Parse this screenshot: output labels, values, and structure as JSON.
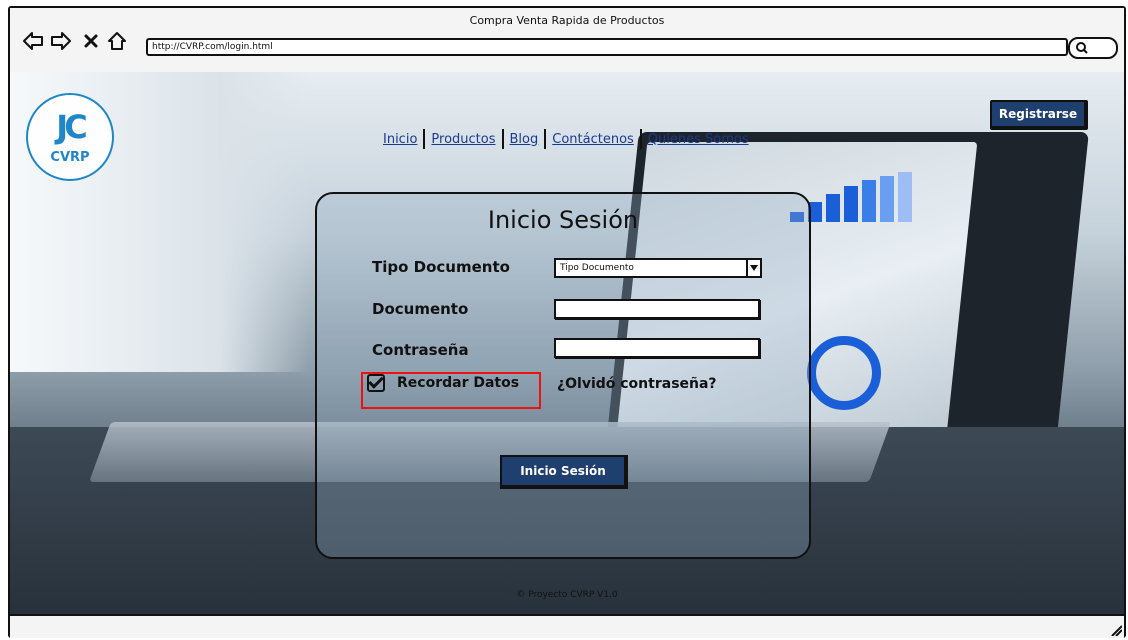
{
  "browser": {
    "title": "Compra Venta Rapida de Productos",
    "url": "http://CVRP.com/login.html"
  },
  "logo": {
    "mark": "JC",
    "text": "CVRP"
  },
  "nav": {
    "items": [
      "Inicio",
      "Productos",
      "Blog",
      "Contáctenos",
      "Quienes Somos"
    ]
  },
  "header": {
    "register_label": "Registrarse"
  },
  "login": {
    "title": "Inicio Sesión",
    "doc_type_label": "Tipo Documento",
    "doc_type_value": "Tipo Documento",
    "document_label": "Documento",
    "password_label": "Contraseña",
    "remember_label": "Recordar Datos",
    "remember_checked": true,
    "forgot_label": "¿Olvidó contraseña?",
    "submit_label": "Inicio Sesión"
  },
  "footer": {
    "text": "© Proyecto CVRP V1.0"
  },
  "colors": {
    "accent": "#1f3f6f",
    "link": "#1a3a8f",
    "logo": "#1f86c8",
    "highlight": "#e11111"
  }
}
